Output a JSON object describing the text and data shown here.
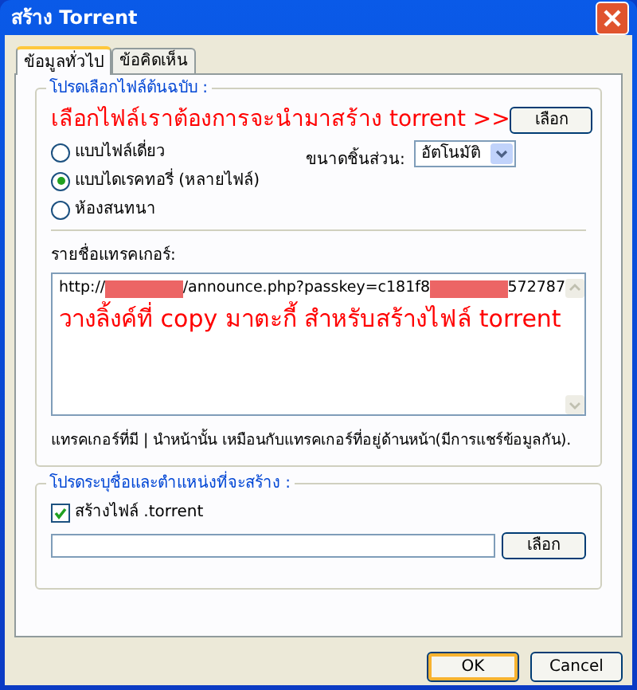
{
  "window": {
    "title": "สร้าง Torrent"
  },
  "tabs": [
    {
      "label": "ข้อมูลทั่วไป",
      "selected": true
    },
    {
      "label": "ข้อคิดเห็น",
      "selected": false
    }
  ],
  "source_group": {
    "legend": "โปรดเลือกไฟล์ต้นฉบับ :",
    "annotation": "เลือกไฟล์เราต้องการจะนำมาสร้าง torrent >>",
    "browse_button": "เลือก",
    "modes": [
      {
        "label": "แบบไฟล์เดี่ยว",
        "selected": false
      },
      {
        "label": "แบบไดเรคทอรี่ (หลายไฟล์)",
        "selected": true
      },
      {
        "label": "ห้องสนทนา",
        "selected": false
      }
    ],
    "piece_size": {
      "label": "ขนาดชิ้นส่วน:",
      "value": "อัตโนมัติ"
    },
    "trackers_label": "รายชื่อแทรคเกอร์:",
    "tracker_url": [
      {
        "kind": "text",
        "text": "http://"
      },
      {
        "kind": "redacted"
      },
      {
        "kind": "text",
        "text": "/announce.php?passkey=c181f8"
      },
      {
        "kind": "redacted"
      },
      {
        "kind": "text",
        "text": "572787"
      }
    ],
    "tracker_annotation": "วางลิ้งค์ที่ copy มาตะกี้ สำหรับสร้างไฟล์ torrent",
    "trackers_note": "แทรคเกอร์ที่มี | นำหน้านั้น เหมือนกับแทรคเกอร์ที่อยู่ด้านหน้า(มีการแชร์ข้อมูลกัน)."
  },
  "output_group": {
    "legend": "โปรดระบุชื่อและตำแหน่งที่จะสร้าง :",
    "create_file": {
      "label": "สร้างไฟล์ .torrent",
      "checked": true
    },
    "browse_button": "เลือก"
  },
  "buttons": [
    {
      "label": "OK",
      "default": true
    },
    {
      "label": "Cancel",
      "default": false
    }
  ]
}
